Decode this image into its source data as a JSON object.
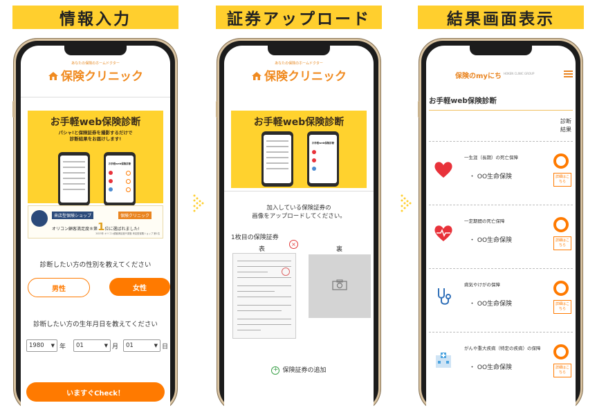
{
  "panels": [
    {
      "banner": "情報入力"
    },
    {
      "banner": "証券アップロード"
    },
    {
      "banner": "結果画面表示"
    }
  ],
  "logo": {
    "sub": "あなたの保険のホームドクター",
    "main": "保険クリニック"
  },
  "hero": {
    "title": "お手軽web保険診断",
    "subtitle": "パシャ!と保険証券を撮影するだけで\n診断結果をお届けします!",
    "mini_screen_title": "お手軽web保険診断"
  },
  "award": {
    "left_badge": "来店型保険ショップ",
    "right_badge": "保険クリニック",
    "text_pre": "オリコン顧客満足度®",
    "rank_prefix": "第",
    "rank": "1",
    "rank_suffix": "位",
    "text_post": "に選ばれました!",
    "footnote": "2023年 オリコン顧客満足度®調査 来店型保険ショップ 第1位"
  },
  "form": {
    "gender_question": "診断したい方の性別を教えてください",
    "male": "男性",
    "female": "女性",
    "birth_question": "診断したい方の生年月日を教えてください",
    "year": "1980",
    "year_unit": "年",
    "month": "01",
    "month_unit": "月",
    "day": "01",
    "day_unit": "日",
    "cta": "いますぐCheck！"
  },
  "upload": {
    "message_line1": "加入している保険証券の",
    "message_line2": "画像をアップロードしてください。",
    "count_label": "1枚目の保険証券",
    "front_label": "表",
    "back_label": "裏",
    "add_more": "保険証券の追加"
  },
  "results": {
    "brand": "保険のmyにち",
    "brand_tag": "HOKEN CLINIC GROUP",
    "title": "お手軽web保険診断",
    "column_head_1": "診断",
    "column_head_2": "結果",
    "rows": [
      {
        "icon": "heart-icon",
        "coverage": "一生涯（長期）の死亡保障",
        "insurer": "・ OO生命保険",
        "detail": "詳細はこちら"
      },
      {
        "icon": "heartbeat-icon",
        "coverage": "一定期間の死亡保障",
        "insurer": "・ OO生命保険",
        "detail": "詳細はこちら"
      },
      {
        "icon": "stethoscope-icon",
        "coverage": "病気やけがの保障",
        "insurer": "・ OO生命保険",
        "detail": "詳細はこちら"
      },
      {
        "icon": "hospital-icon",
        "coverage": "がんや重大疾病（特定の疾病）の保障",
        "insurer": "・ OO生命保険",
        "detail": "詳細はこちら"
      }
    ]
  },
  "colors": {
    "banner": "#ffcf2e",
    "accent": "#ff7a00",
    "heart": "#e8323a"
  }
}
